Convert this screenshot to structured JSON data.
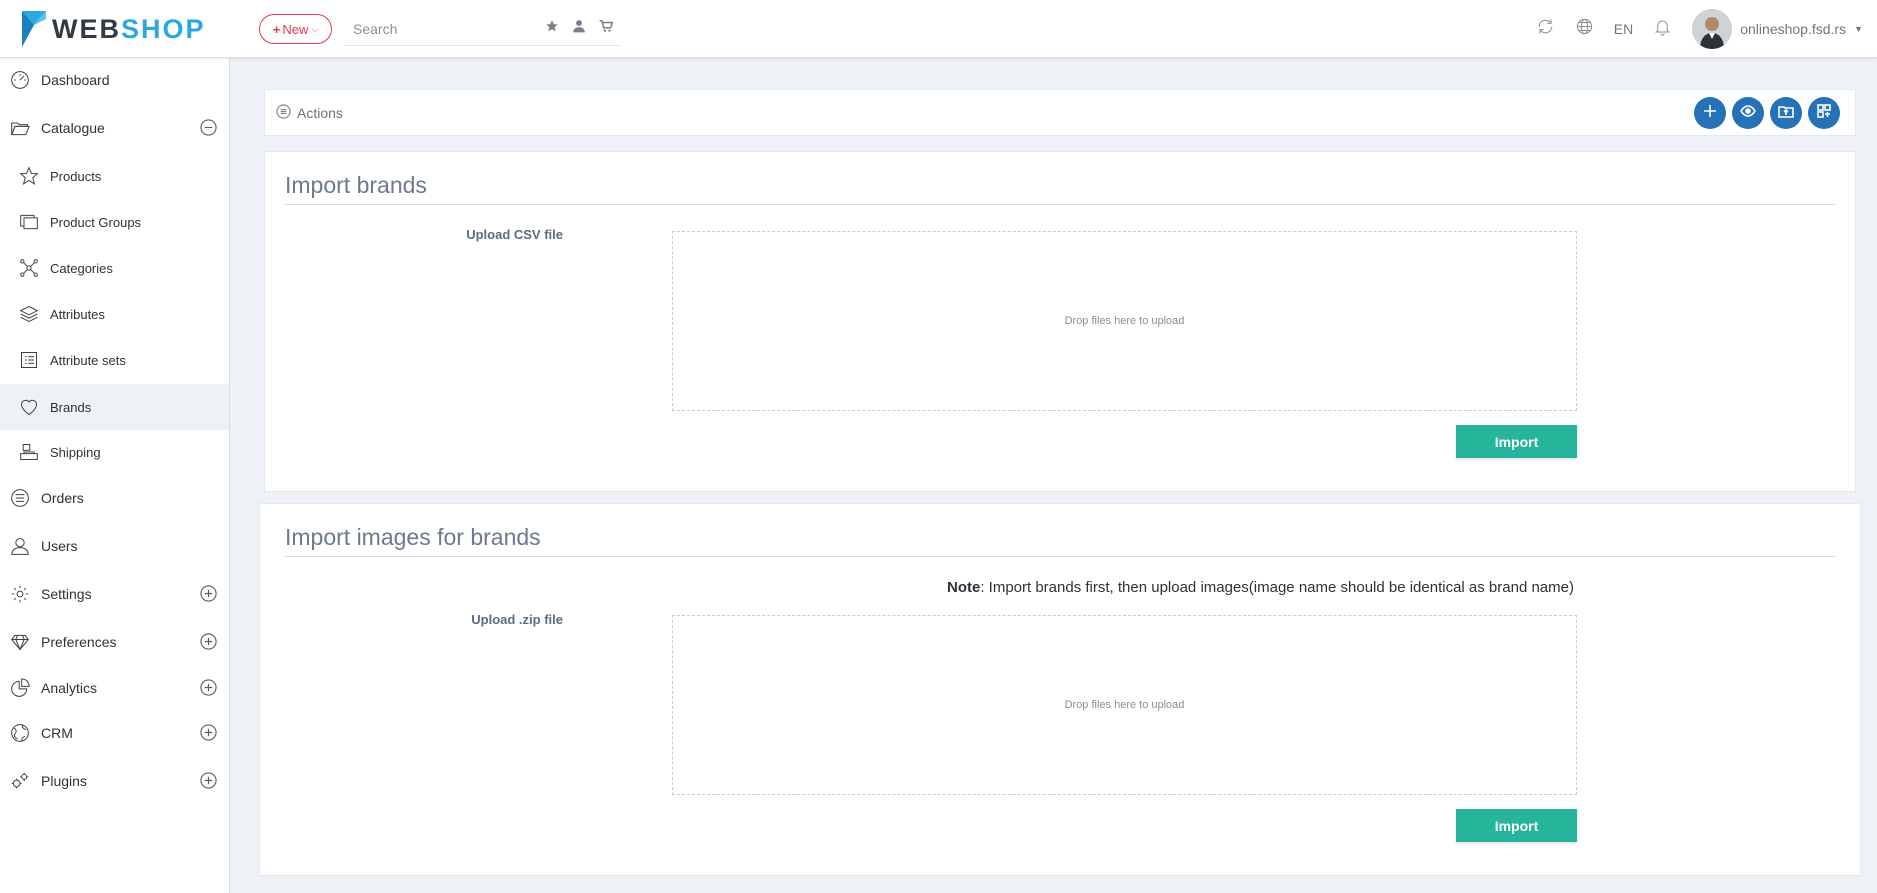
{
  "header": {
    "logo_web": "WEB",
    "logo_shop": "SHOP",
    "new_button": "New",
    "search_placeholder": "Search",
    "language": "EN",
    "user_name": "onlineshop.fsd.rs"
  },
  "sidebar": {
    "dashboard": "Dashboard",
    "catalogue": "Catalogue",
    "products": "Products",
    "product_groups": "Product Groups",
    "categories": "Categories",
    "attributes": "Attributes",
    "attribute_sets": "Attribute sets",
    "brands": "Brands",
    "shipping": "Shipping",
    "orders": "Orders",
    "users": "Users",
    "settings": "Settings",
    "preferences": "Preferences",
    "analytics": "Analytics",
    "crm": "CRM",
    "plugins": "Plugins"
  },
  "actions": {
    "label": "Actions"
  },
  "import_brands": {
    "title": "Import brands",
    "field_label": "Upload CSV file",
    "dropzone_text": "Drop files here to upload",
    "button": "Import"
  },
  "import_images": {
    "title": "Import images for brands",
    "note_label": "Note",
    "note_text": ": Import brands first, then upload images(image name should be identical as brand name)",
    "field_label": "Upload .zip file",
    "dropzone_text": "Drop files here to upload",
    "button": "Import"
  },
  "colors": {
    "accent_blue": "#2572b7",
    "import_green": "#26b59b",
    "new_red": "#e0394c",
    "logo_blue": "#2aa8df"
  }
}
